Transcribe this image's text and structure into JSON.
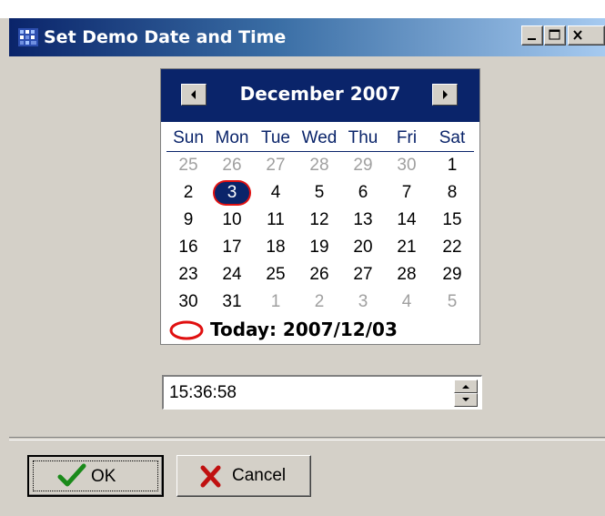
{
  "window": {
    "title": "Set Demo Date and Time",
    "icon": "app-icon"
  },
  "calendar": {
    "month_title": "December 2007",
    "prev_icon": "triangle-left-icon",
    "next_icon": "triangle-right-icon",
    "weekdays": [
      "Sun",
      "Mon",
      "Tue",
      "Wed",
      "Thu",
      "Fri",
      "Sat"
    ],
    "weeks": [
      [
        "25",
        "26",
        "27",
        "28",
        "29",
        "30",
        "1"
      ],
      [
        "2",
        "3",
        "4",
        "5",
        "6",
        "7",
        "8"
      ],
      [
        "9",
        "10",
        "11",
        "12",
        "13",
        "14",
        "15"
      ],
      [
        "16",
        "17",
        "18",
        "19",
        "20",
        "21",
        "22"
      ],
      [
        "23",
        "24",
        "25",
        "26",
        "27",
        "28",
        "29"
      ],
      [
        "30",
        "31",
        "1",
        "2",
        "3",
        "4",
        "5"
      ]
    ],
    "selected_day": "3",
    "today_label": "Today: 2007/12/03",
    "accent_color": "#0a246a",
    "today_marker_color": "#e01010"
  },
  "time": {
    "value": "15:36:58"
  },
  "buttons": {
    "ok_label": "OK",
    "cancel_label": "Cancel"
  }
}
